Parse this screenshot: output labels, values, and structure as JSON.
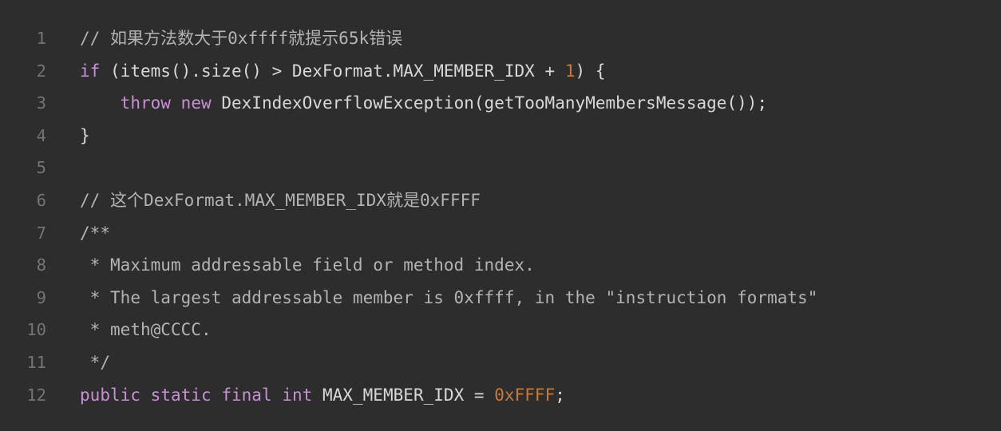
{
  "editor": {
    "name": "code-snippet-viewer",
    "language": "java",
    "background_color": "#2d2d2d",
    "gutter_color": "#2b2b2b",
    "line_number_color": "#747474",
    "colors": {
      "plain": "#d8d8d8",
      "comment": "#b3b3b3",
      "keyword": "#c98fd4",
      "number": "#cc7832"
    },
    "first_line_number": 1,
    "last_line_number": 12,
    "total_lines": 12
  },
  "lines": [
    {
      "number": "1",
      "text": "// 如果方法数大于0xffff就提示65k错误",
      "tokens": [
        {
          "t": "// 如果方法数大于0xffff就提示65k错误",
          "c": "comment"
        }
      ]
    },
    {
      "number": "2",
      "text": "if (items().size() > DexFormat.MAX_MEMBER_IDX + 1) {",
      "tokens": [
        {
          "t": "if",
          "c": "keyword"
        },
        {
          "t": " (items().size() > DexFormat.MAX_MEMBER_IDX + ",
          "c": "plain"
        },
        {
          "t": "1",
          "c": "number"
        },
        {
          "t": ") {",
          "c": "plain"
        }
      ]
    },
    {
      "number": "3",
      "text": "    throw new DexIndexOverflowException(getTooManyMembersMessage());",
      "tokens": [
        {
          "t": "    ",
          "c": "plain"
        },
        {
          "t": "throw",
          "c": "keyword"
        },
        {
          "t": " ",
          "c": "plain"
        },
        {
          "t": "new",
          "c": "keyword"
        },
        {
          "t": " DexIndexOverflowException(getTooManyMembersMessage());",
          "c": "plain"
        }
      ]
    },
    {
      "number": "4",
      "text": "}",
      "tokens": [
        {
          "t": "}",
          "c": "plain"
        }
      ]
    },
    {
      "number": "5",
      "text": "",
      "tokens": []
    },
    {
      "number": "6",
      "text": "// 这个DexFormat.MAX_MEMBER_IDX就是0xFFFF",
      "tokens": [
        {
          "t": "// 这个DexFormat.MAX_MEMBER_IDX就是0xFFFF",
          "c": "comment"
        }
      ]
    },
    {
      "number": "7",
      "text": "/**",
      "tokens": [
        {
          "t": "/**",
          "c": "comment"
        }
      ]
    },
    {
      "number": "8",
      "text": " * Maximum addressable field or method index.",
      "tokens": [
        {
          "t": " * Maximum addressable field or method index.",
          "c": "comment"
        }
      ]
    },
    {
      "number": "9",
      "text": " * The largest addressable member is 0xffff, in the \"instruction formats\"",
      "tokens": [
        {
          "t": " * The largest addressable member is 0xffff, in the \"instruction formats\"",
          "c": "comment"
        }
      ]
    },
    {
      "number": "10",
      "text": " * meth@CCCC.",
      "tokens": [
        {
          "t": " * meth@CCCC.",
          "c": "comment"
        }
      ]
    },
    {
      "number": "11",
      "text": " */",
      "tokens": [
        {
          "t": " */",
          "c": "comment"
        }
      ]
    },
    {
      "number": "12",
      "text": "public static final int MAX_MEMBER_IDX = 0xFFFF;",
      "tokens": [
        {
          "t": "public",
          "c": "keyword"
        },
        {
          "t": " ",
          "c": "plain"
        },
        {
          "t": "static",
          "c": "keyword"
        },
        {
          "t": " ",
          "c": "plain"
        },
        {
          "t": "final",
          "c": "keyword"
        },
        {
          "t": " ",
          "c": "plain"
        },
        {
          "t": "int",
          "c": "keyword"
        },
        {
          "t": " MAX_MEMBER_IDX = ",
          "c": "plain"
        },
        {
          "t": "0xFFFF",
          "c": "number"
        },
        {
          "t": ";",
          "c": "plain"
        }
      ]
    }
  ]
}
